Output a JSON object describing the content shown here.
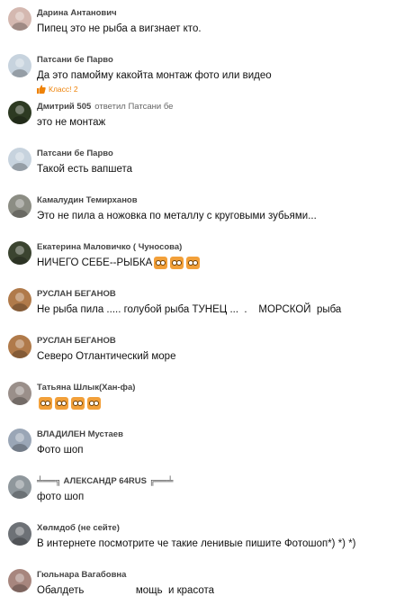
{
  "comments": [
    {
      "author": "Дарина Антанович",
      "reply_to": "",
      "text": "Пипец это не рыба а вигзнает кто.",
      "avatar": "#d4b8b0",
      "avatar_icon": "person-photo-icon"
    },
    {
      "author": "Патсани бе Парво",
      "reply_to": "",
      "text": "Да это памойму какойта монтаж фото или видео",
      "like": "Класс! 2",
      "avatar": "#c7d3de",
      "avatar_icon": "cartoon-avatar-icon"
    },
    {
      "author": "Дмитрий 505",
      "reply_to": "ответил Патсани бе",
      "text": "это не монтаж",
      "avatar": "#2d3a22",
      "avatar_icon": "person-photo-icon"
    },
    {
      "author": "Патсани бе Парво",
      "reply_to": "",
      "text": "Такой есть вапшета",
      "avatar": "#c7d3de",
      "avatar_icon": "cartoon-avatar-icon"
    },
    {
      "author": "Камалудин Темирханов",
      "reply_to": "",
      "text": "Это не пила а ножовка по металлу с круговыми зубьями...",
      "avatar": "#8c8d84",
      "avatar_icon": "person-photo-icon"
    },
    {
      "author": "Екатерина Маловичко ( Чуносова)",
      "reply_to": "",
      "text": "НИЧЕГО СЕБЕ--РЫБКА",
      "emoji_count": 3,
      "avatar": "#3b4430",
      "avatar_icon": "person-photo-icon"
    },
    {
      "author": "РУСЛАН БЕГАНОВ",
      "reply_to": "",
      "text": "Не рыба пила ..... голубой рыба ТУНЕЦ ...  .    МОРСКОЙ  рыба",
      "avatar": "#b07a4a",
      "avatar_icon": "person-photo-icon"
    },
    {
      "author": "РУСЛАН БЕГАНОВ",
      "reply_to": "",
      "text": "Северо Отлантический море",
      "avatar": "#b07a4a",
      "avatar_icon": "person-photo-icon"
    },
    {
      "author": "Татьяна Шлык(Хан-фа)",
      "reply_to": "",
      "text": "",
      "emoji_count": 4,
      "avatar": "#9a8f8a",
      "avatar_icon": "person-photo-icon"
    },
    {
      "author": "ВЛАДИЛЕН Мустаев",
      "reply_to": "",
      "text": "Фото шоп",
      "avatar": "#9aa6b6",
      "avatar_icon": "person-photo-icon"
    },
    {
      "author": "╧══╗ АЛЕКСАНДР 64RUS ╔══╧",
      "reply_to": "",
      "text": "фото шоп",
      "avatar": "#8f979c",
      "avatar_icon": "person-photo-icon"
    },
    {
      "author": "Хөлмдоб (не сейте)",
      "reply_to": "",
      "text": "В интернете посмотрите че такие ленивые пишите Фотошоп*) *) *)",
      "avatar": "#6d7176",
      "avatar_icon": "person-photo-icon"
    },
    {
      "author": "Гюльнара Вагабовна",
      "reply_to": "",
      "text": "Обалдеть                  мощь  и красота",
      "avatar": "#a7867e",
      "avatar_icon": "person-photo-icon"
    }
  ],
  "colors": {
    "like": "#ee8208",
    "like_icon": "thumbs-up-icon"
  }
}
